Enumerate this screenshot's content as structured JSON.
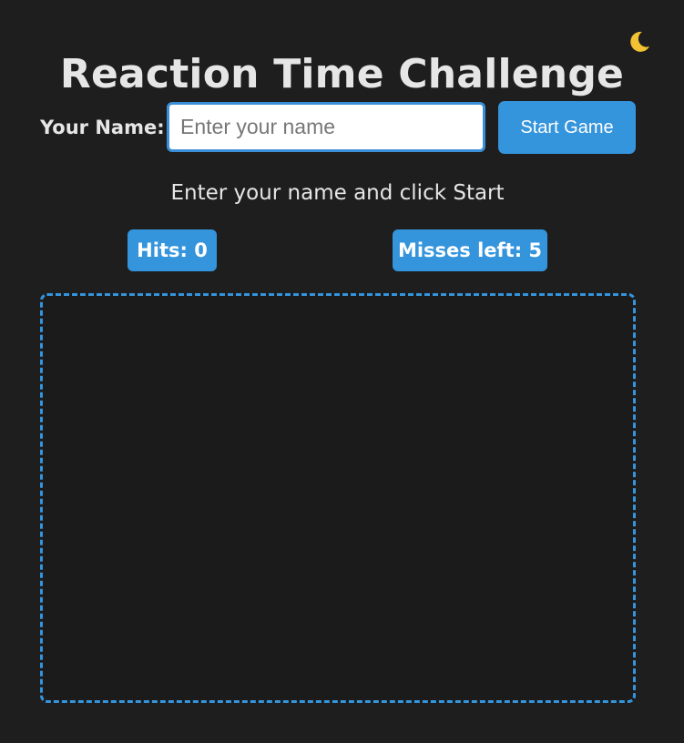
{
  "header": {
    "title": "Reaction Time Challenge",
    "theme_icon": "moon-icon",
    "theme_glyph": "🌙"
  },
  "form": {
    "name_label": "Your Name:",
    "name_placeholder": "Enter your name",
    "name_value": "",
    "start_label": "Start Game"
  },
  "status": {
    "message": "Enter your name and click Start"
  },
  "stats": {
    "hits_label": "Hits: 0",
    "misses_label": "Misses left: 5"
  },
  "colors": {
    "background": "#1e1e1e",
    "accent": "#3494dc",
    "text": "#e6e6e6",
    "moon": "#f2c233"
  }
}
